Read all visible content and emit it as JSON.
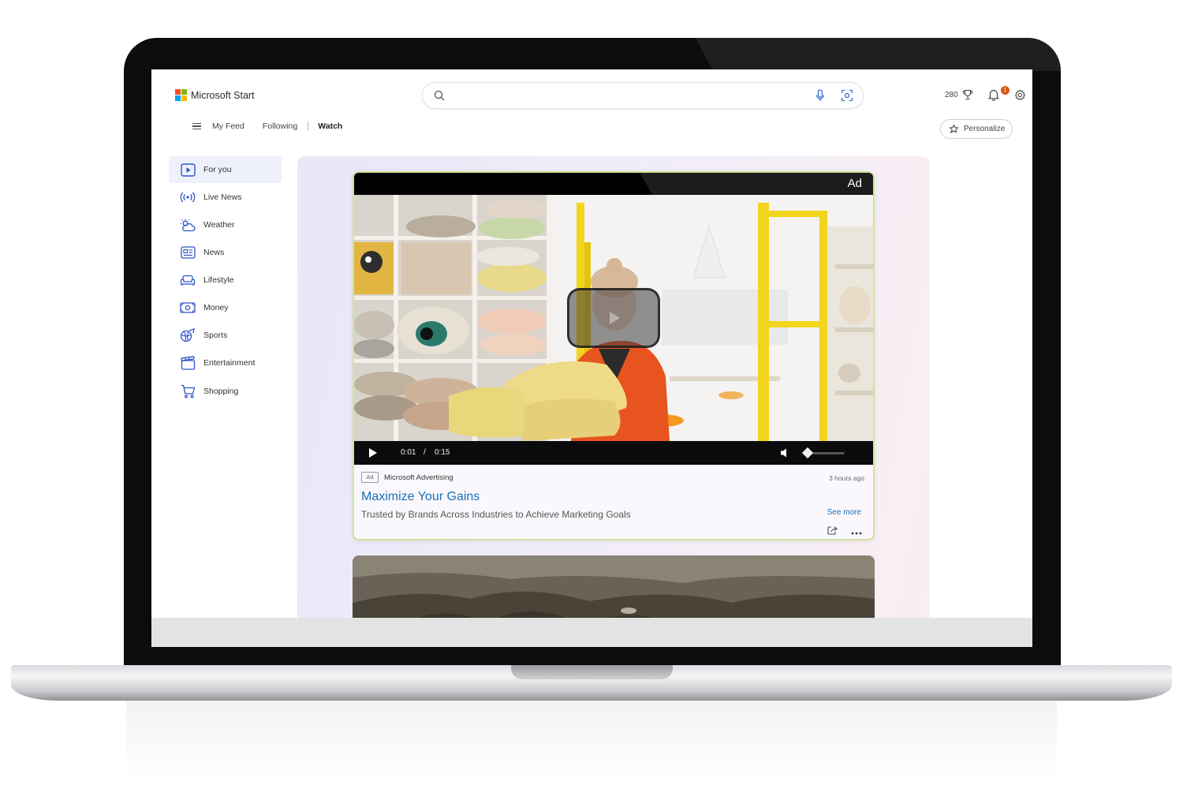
{
  "header": {
    "logo_text": "Microsoft Start",
    "search_placeholder": "",
    "points": "280",
    "notification_count": "1",
    "personalize_label": "Personalize"
  },
  "nav": {
    "items": [
      {
        "label": "My Feed"
      },
      {
        "label": "Following"
      },
      {
        "label": "Watch"
      }
    ]
  },
  "sidebar": {
    "items": [
      {
        "label": "For you"
      },
      {
        "label": "Live News"
      },
      {
        "label": "Weather"
      },
      {
        "label": "News"
      },
      {
        "label": "Lifestyle"
      },
      {
        "label": "Money"
      },
      {
        "label": "Sports"
      },
      {
        "label": "Entertainment"
      },
      {
        "label": "Shopping"
      }
    ]
  },
  "card": {
    "ad_label": "Ad",
    "time_current": "0:01",
    "time_separator": "/",
    "time_total": "0:15",
    "volume_level": 0.1,
    "ad_tag": "Ad",
    "source": "Microsoft Advertising",
    "time_ago": "3 hours ago",
    "title": "Maximize Your Gains",
    "description": "Trusted by Brands Across Industries to Achieve Marketing Goals",
    "see_more": "See more"
  },
  "colors": {
    "accent": "#1a6fb8",
    "card_border": "#cfe59a",
    "badge": "#e0541c",
    "sidebar_icon": "#2e53c9"
  }
}
